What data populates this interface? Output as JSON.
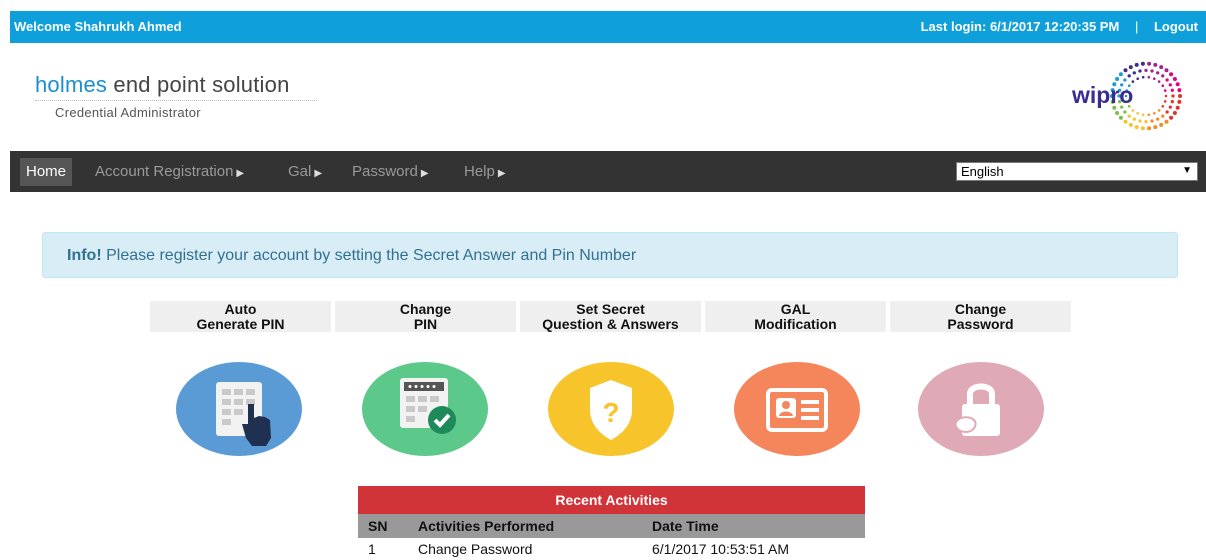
{
  "topbar": {
    "welcome": "Welcome Shahrukh Ahmed",
    "last_login": "Last login: 6/1/2017 12:20:35 PM",
    "separator": "|",
    "logout": "Logout"
  },
  "brand": {
    "name_part1": "holmes",
    "name_part2": " end point solution",
    "subtitle": "Credential Administrator",
    "logo_text": "wipro"
  },
  "nav": {
    "items": [
      {
        "label": "Home",
        "active": true
      },
      {
        "label": "Account Registration",
        "caret": "▶"
      },
      {
        "label": "Gal",
        "caret": "▶"
      },
      {
        "label": "Password",
        "caret": "▶"
      },
      {
        "label": "Help",
        "caret": "▶"
      }
    ],
    "language": {
      "selected": "English",
      "arrow": "▼"
    }
  },
  "alert": {
    "strong": "Info!",
    "message": " Please register your account by setting the Secret Answer and Pin Number"
  },
  "tiles": [
    {
      "line1": "Auto",
      "line2": "Generate PIN",
      "icon": "keypad-hand-icon",
      "color": "#5b9bd5"
    },
    {
      "line1": "Change",
      "line2": "PIN",
      "icon": "pin-check-icon",
      "color": "#5cc98b"
    },
    {
      "line1": "Set Secret",
      "line2": "Question & Answers",
      "icon": "shield-question-icon",
      "color": "#f7c52b"
    },
    {
      "line1": "GAL",
      "line2": "Modification",
      "icon": "id-card-icon",
      "color": "#f5855a"
    },
    {
      "line1": "Change",
      "line2": "Password",
      "icon": "padlock-icon",
      "color": "#dfa9b6"
    }
  ],
  "activities": {
    "title": "Recent Activities",
    "columns": [
      "SN",
      "Activities Performed",
      "Date Time"
    ],
    "rows": [
      [
        "1",
        "Change Password",
        "6/1/2017 10:53:51 AM"
      ]
    ]
  },
  "colors": {
    "topbar": "#0fa0dc",
    "nav": "#333333",
    "activities_header": "#d13438"
  }
}
